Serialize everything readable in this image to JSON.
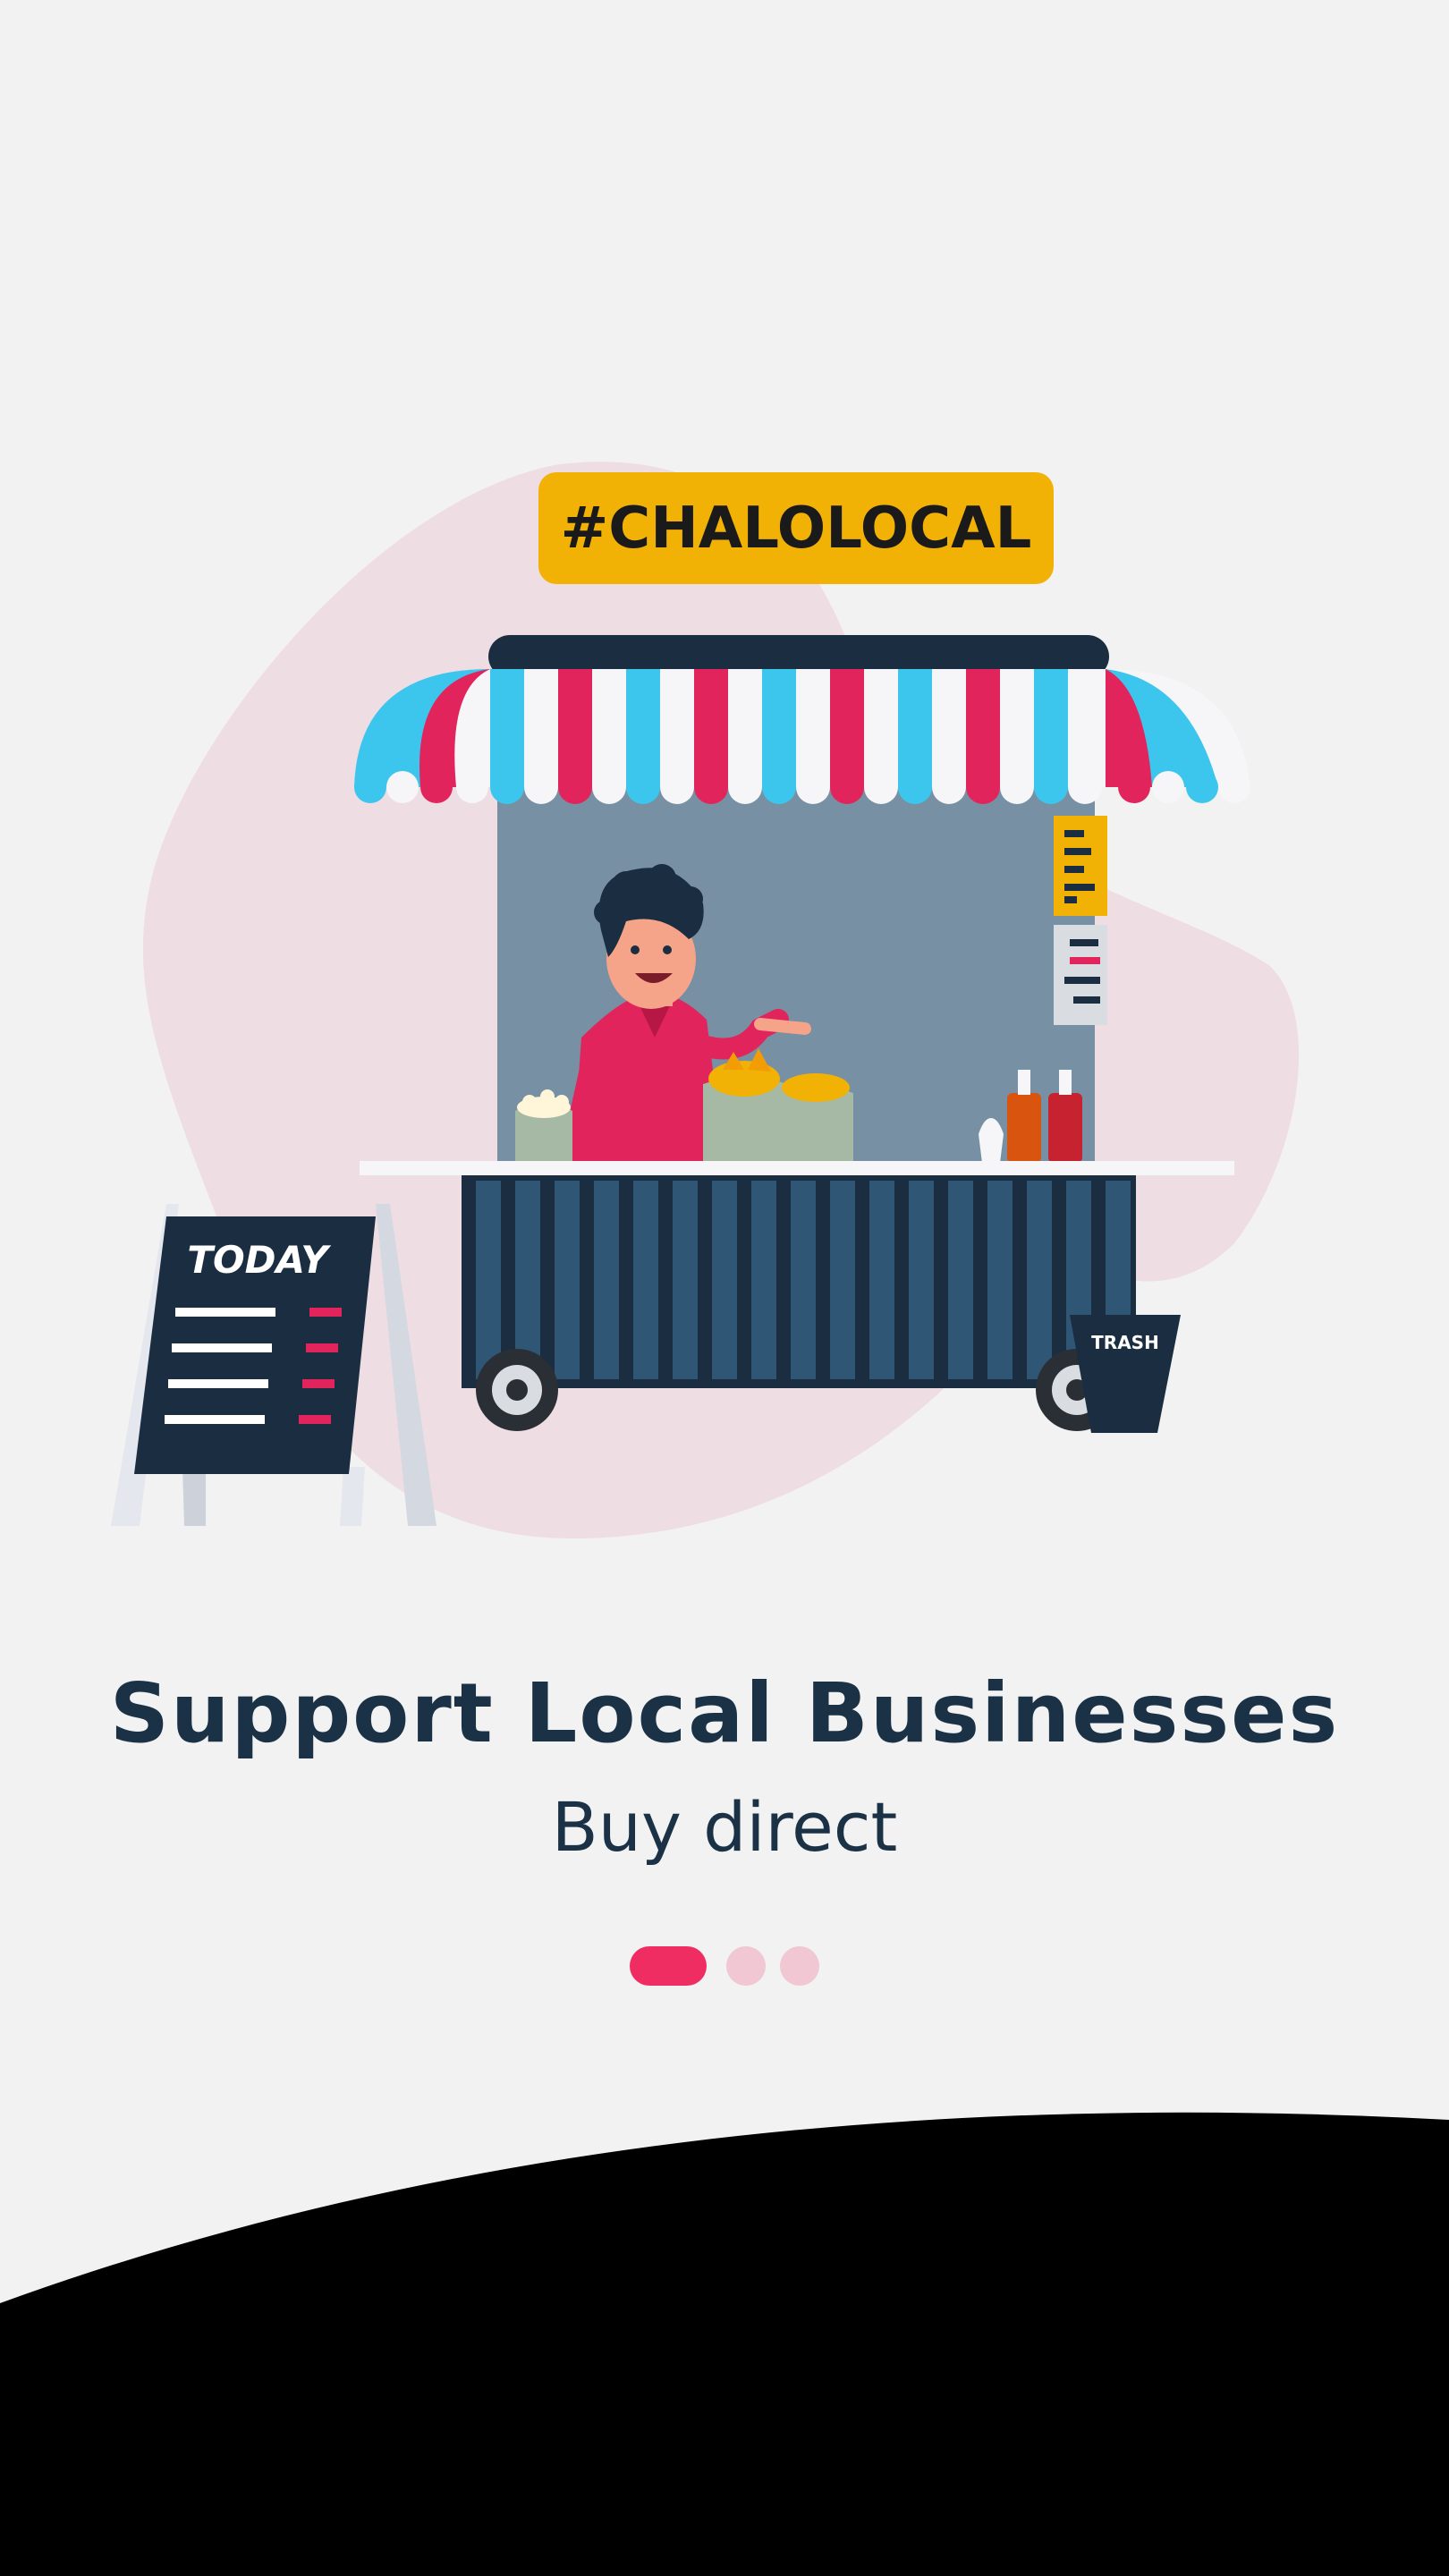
{
  "illustration": {
    "badge": "#CHALOLOCAL",
    "board_title": "TODAY",
    "trash_label": "TRASH"
  },
  "onboarding": {
    "title": "Support Local Businesses",
    "subtitle": "Buy direct",
    "pagination": {
      "current": 1,
      "total": 3
    }
  },
  "colors": {
    "background": "#f2f2f2",
    "accent": "#ef2d63",
    "text": "#1b3145",
    "badge": "#f2b205",
    "dot_inactive": "#f0c7d3"
  }
}
